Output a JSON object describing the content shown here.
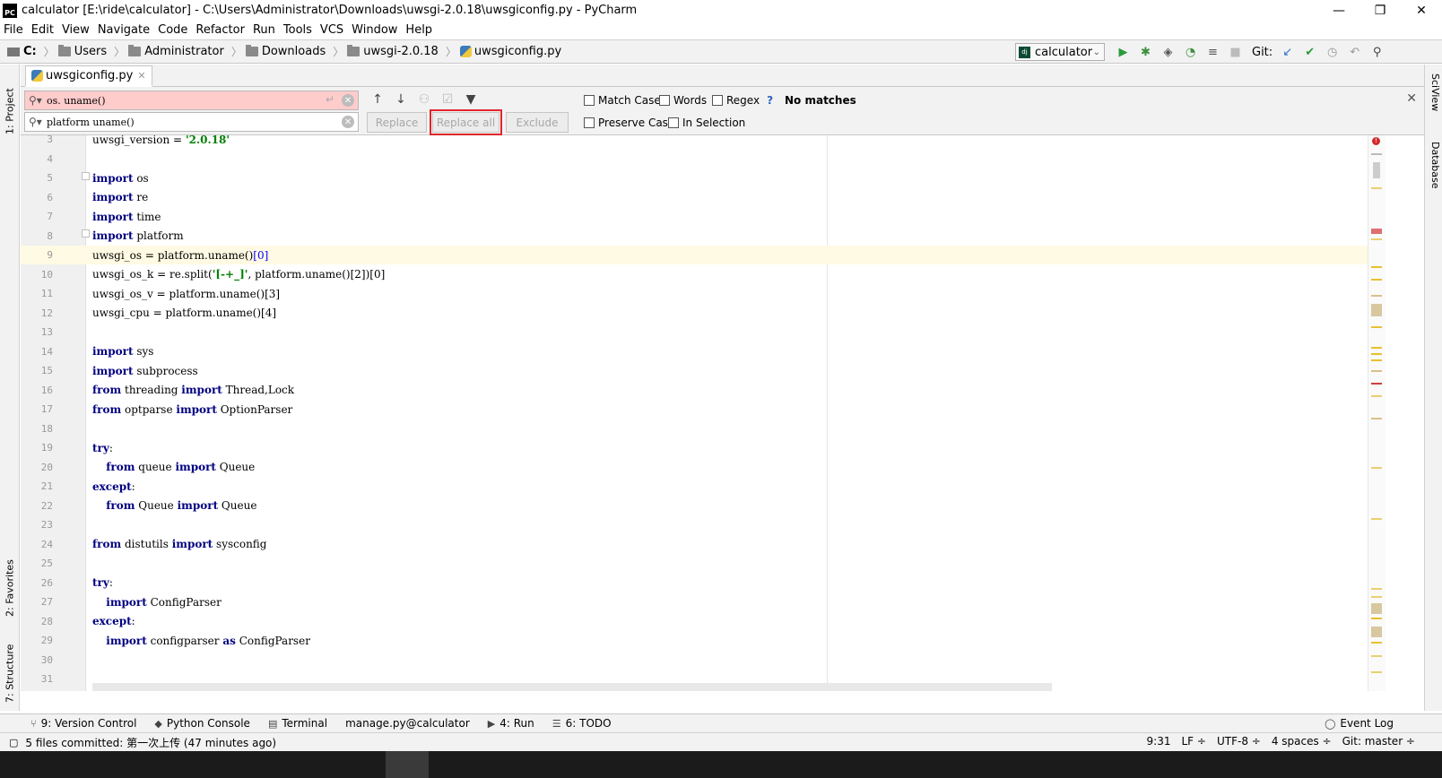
{
  "window": {
    "title": "calculator [E:\\ride\\calculator] - C:\\Users\\Administrator\\Downloads\\uwsgi-2.0.18\\uwsgiconfig.py - PyCharm",
    "minimize": "—",
    "restore": "❐",
    "close": "✕"
  },
  "menu": [
    "File",
    "Edit",
    "View",
    "Navigate",
    "Code",
    "Refactor",
    "Run",
    "Tools",
    "VCS",
    "Window",
    "Help"
  ],
  "breadcrumb": [
    "C:",
    "Users",
    "Administrator",
    "Downloads",
    "uwsgi-2.0.18",
    "uwsgiconfig.py"
  ],
  "run_config": "calculator",
  "git_label": "Git:",
  "tab": {
    "label": "uwsgiconfig.py"
  },
  "find": {
    "search_value": "os. uname()",
    "replace_value": "platform uname()",
    "replace_label": "Replace",
    "replace_all_label": "Replace all",
    "exclude_label": "Exclude",
    "match_case": "Match Case",
    "words": "Words",
    "regex": "Regex",
    "help": "?",
    "preserve_case": "Preserve Case",
    "in_selection": "In Selection",
    "status": "No matches"
  },
  "editor": {
    "lines": [
      {
        "n": "3",
        "html": "uwsgi_version = <span class='str'>'2.0.18'</span>"
      },
      {
        "n": "4",
        "html": ""
      },
      {
        "n": "5",
        "html": "<span class='kw'>import</span> os"
      },
      {
        "n": "6",
        "html": "<span class='kw'>import</span> re"
      },
      {
        "n": "7",
        "html": "<span class='kw'>import</span> time"
      },
      {
        "n": "8",
        "html": "<span class='kw'>import</span> platform"
      },
      {
        "n": "9",
        "html": "uwsgi_os = platform.uname()<span class='num'>[0]</span>"
      },
      {
        "n": "10",
        "html": "uwsgi_os_k = re.split(<span class='str'>'[-+_]'</span>, platform.uname()[2])[0]"
      },
      {
        "n": "11",
        "html": "uwsgi_os_v = platform.uname()[3]"
      },
      {
        "n": "12",
        "html": "uwsgi_cpu = platform.uname()[4]"
      },
      {
        "n": "13",
        "html": ""
      },
      {
        "n": "14",
        "html": "<span class='kw'>import</span> sys"
      },
      {
        "n": "15",
        "html": "<span class='kw'>import</span> subprocess"
      },
      {
        "n": "16",
        "html": "<span class='kw'>from</span> threading <span class='kw'>import</span> Thread,Lock"
      },
      {
        "n": "17",
        "html": "<span class='kw'>from</span> optparse <span class='kw'>import</span> OptionParser"
      },
      {
        "n": "18",
        "html": ""
      },
      {
        "n": "19",
        "html": "<span class='kw'>try</span>:"
      },
      {
        "n": "20",
        "html": "    <span class='kw'>from</span> queue <span class='kw'>import</span> Queue"
      },
      {
        "n": "21",
        "html": "<span class='kw'>except</span>:"
      },
      {
        "n": "22",
        "html": "    <span class='kw'>from</span> Queue <span class='kw'>import</span> Queue"
      },
      {
        "n": "23",
        "html": ""
      },
      {
        "n": "24",
        "html": "<span class='kw'>from</span> distutils <span class='kw'>import</span> sysconfig"
      },
      {
        "n": "25",
        "html": ""
      },
      {
        "n": "26",
        "html": "<span class='kw'>try</span>:"
      },
      {
        "n": "27",
        "html": "    <span class='kw'>import</span> ConfigParser"
      },
      {
        "n": "28",
        "html": "<span class='kw'>except</span>:"
      },
      {
        "n": "29",
        "html": "    <span class='kw'>import</span> configparser <span class='kw'>as</span> ConfigParser"
      },
      {
        "n": "30",
        "html": ""
      },
      {
        "n": "31",
        "html": ""
      }
    ],
    "highlighted_line": "9"
  },
  "left_tabs": [
    "1: Project",
    "2: Favorites",
    "7: Structure"
  ],
  "right_tabs": [
    "SciView",
    "Database"
  ],
  "bottom_tools": [
    {
      "icon": "⑂",
      "label": "9: Version Control"
    },
    {
      "icon": "◆",
      "label": "Python Console"
    },
    {
      "icon": "▤",
      "label": "Terminal"
    },
    {
      "icon": "",
      "label": "manage.py@calculator"
    },
    {
      "icon": "▶",
      "label": "4: Run"
    },
    {
      "icon": "☰",
      "label": "6: TODO"
    }
  ],
  "event_log": "Event Log",
  "status": {
    "message": "5 files committed: 第一次上传 (47 minutes ago)",
    "position": "9:31",
    "line_sep": "LF ÷",
    "encoding": "UTF-8 ÷",
    "indent": "4 spaces ÷",
    "git_branch": "Git: master ÷"
  }
}
